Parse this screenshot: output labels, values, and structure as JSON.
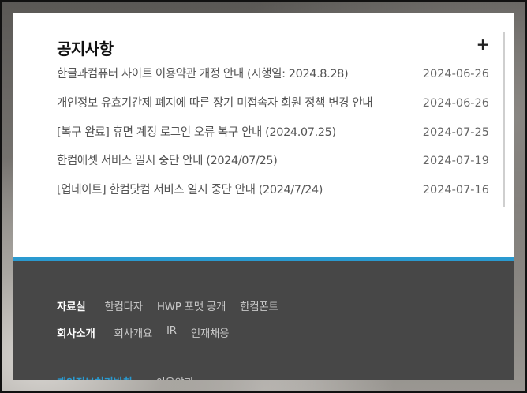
{
  "notice": {
    "title": "공지사항",
    "more_label": "+",
    "items": [
      {
        "title": "한글과컴퓨터 사이트 이용약관 개정 안내 (시행일: 2024.8.28)",
        "date": "2024-06-26"
      },
      {
        "title": "개인정보 유효기간제 폐지에 따른 장기 미접속자 회원 정책 변경 안내",
        "date": "2024-06-26"
      },
      {
        "title": "[복구 완료] 휴면 계정 로그인 오류 복구 안내 (2024.07.25)",
        "date": "2024-07-25"
      },
      {
        "title": "한컴애셋 서비스 일시 중단 안내 (2024/07/25)",
        "date": "2024-07-19"
      },
      {
        "title": "[업데이트] 한컴닷컴 서비스 일시 중단 안내 (2024/7/24)",
        "date": "2024-07-16"
      }
    ]
  },
  "footer": {
    "row1": {
      "heading": "자료실",
      "links": [
        "한컴타자",
        "HWP 포맷 공개",
        "한컴폰트"
      ]
    },
    "row2": {
      "heading": "회사소개",
      "links": [
        "회사개요",
        "IR",
        "인재채용"
      ]
    },
    "bottom": {
      "privacy": "개인정보처리방침",
      "terms": "이용약관"
    },
    "accent_color": "#2a9ad0"
  }
}
